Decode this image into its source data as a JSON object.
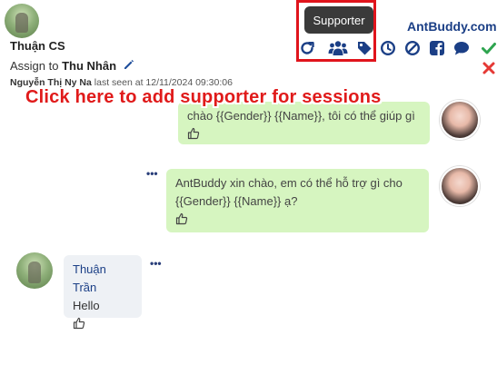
{
  "header": {
    "user_name": "Thuận CS",
    "assign_prefix": "Assign to",
    "assignee": "Thu Nhân",
    "seen_user": "Nguyễn Thị Ny Na",
    "seen_text": "last seen at 12/11/2024 09:30:06",
    "brand": "AntBuddy.com"
  },
  "toolbar": {
    "tooltip": "Supporter",
    "icons": [
      "refresh-icon",
      "supporter-icon",
      "tag-icon",
      "history-icon",
      "block-icon",
      "facebook-icon",
      "chat-icon",
      "check-icon",
      "close-icon"
    ],
    "colors": {
      "primary": "#1b3f86",
      "check": "#2ea44f",
      "close": "#e53935"
    }
  },
  "annotation": {
    "text": "Click here to add supporter for sessions",
    "color": "#e01a1a"
  },
  "messages": [
    {
      "from": "agent",
      "text": "chào {{Gender}} {{Name}}, tôi có thể giúp gì"
    },
    {
      "from": "agent",
      "text_line1": "AntBuddy xin chào, em có thể hỗ trợ gì cho",
      "text_line2": "{{Gender}} {{Name}} ạ?",
      "menu": "•••"
    },
    {
      "from": "customer",
      "sender": "Thuận Trần",
      "text": "Hello",
      "menu": "•••"
    }
  ]
}
